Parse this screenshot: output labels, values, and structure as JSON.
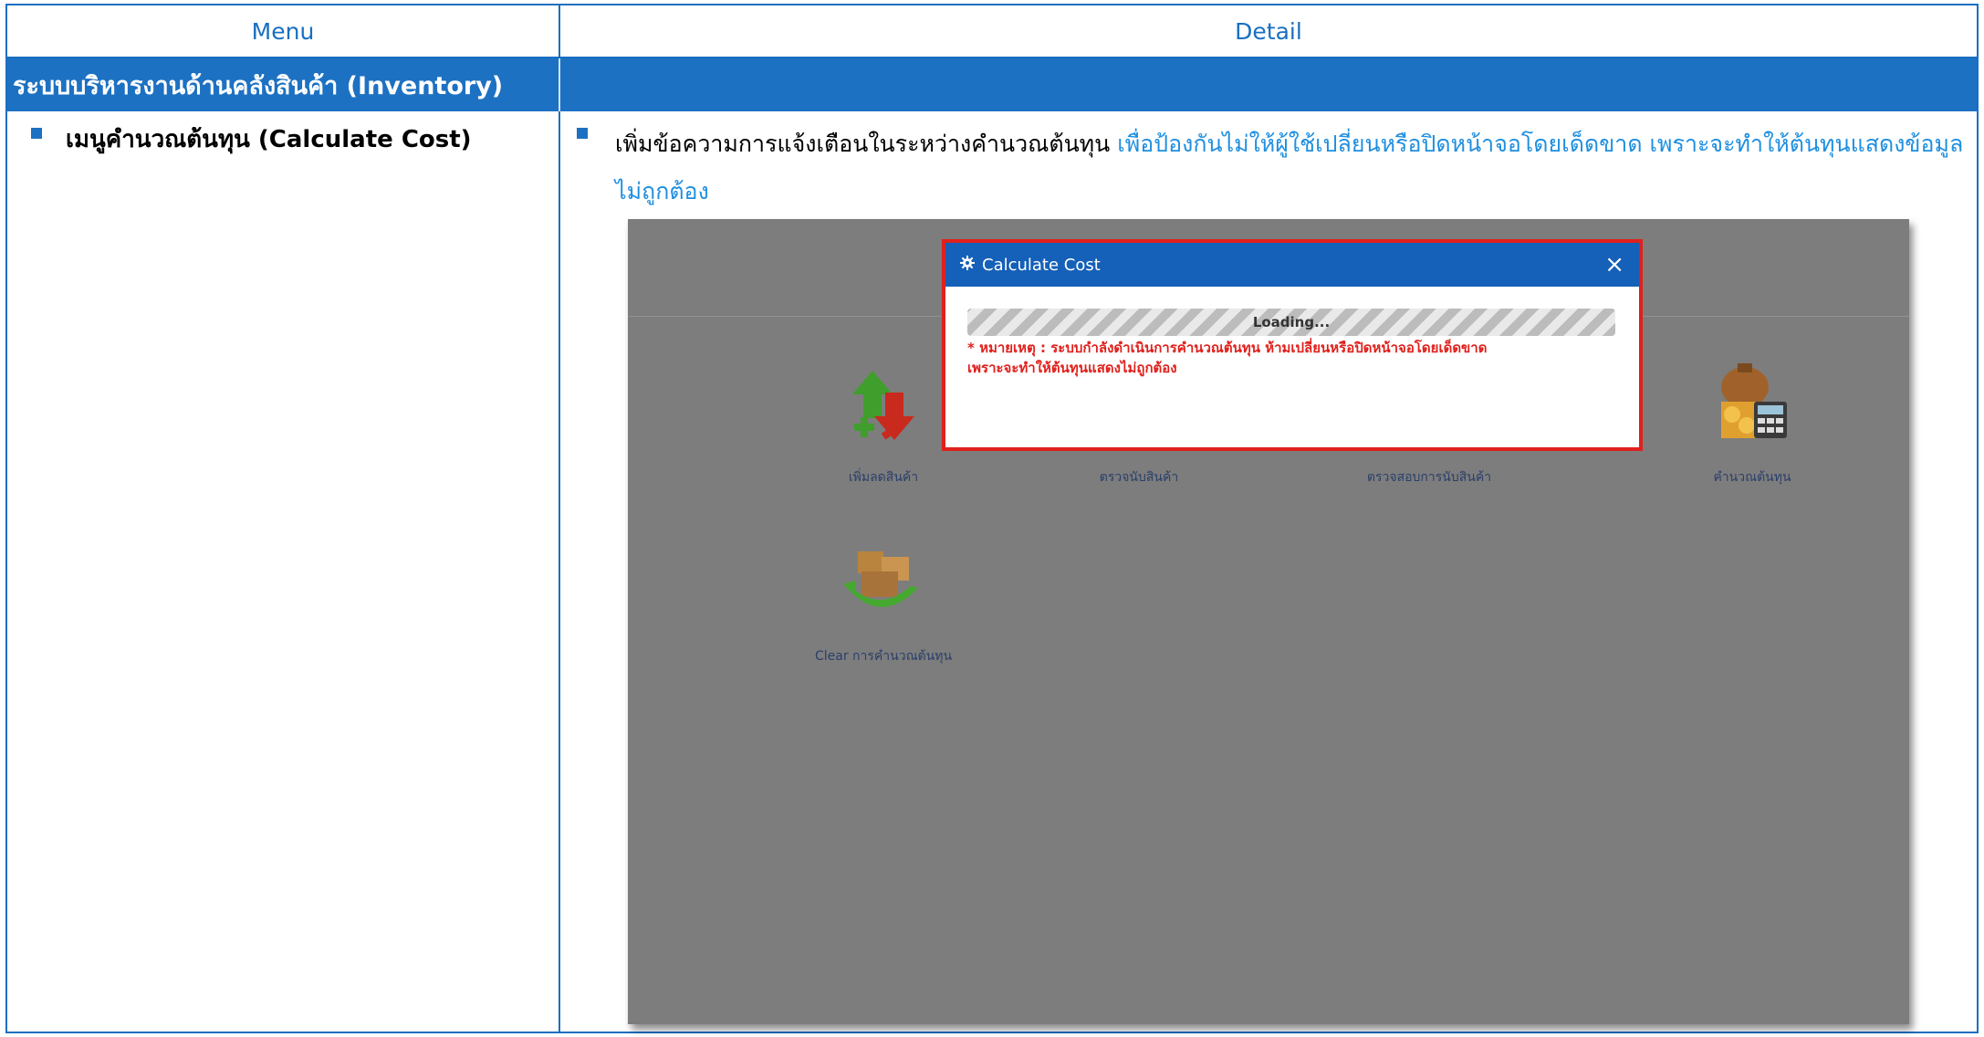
{
  "table": {
    "col_menu": "Menu",
    "col_detail": "Detail"
  },
  "section": {
    "title": "ระบบบริหารงานด้านคลังสินค้า (Inventory)"
  },
  "row": {
    "menu_label": "เมนูคำนวณต้นทุน (Calculate Cost)",
    "detail_plain": "เพิ่มข้อความการแจ้งเตือนในระหว่างคำนวณต้นทุน ",
    "detail_highlight": "เพื่อป้องกันไม่ให้ผู้ใช้เปลี่ยนหรือปิดหน้าจอโดยเด็ดขาด เพราะจะทำให้ต้นทุนแสดงข้อมูลไม่ถูกต้อง"
  },
  "screenshot": {
    "modal": {
      "title": "Calculate Cost",
      "close": "×",
      "progress_label": "Loading...",
      "note_line1": "* หมายเหตุ : ระบบกำลังดำเนินการคำนวณต้นทุน ห้ามเปลี่ยนหรือปิดหน้าจอโดยเด็ดขาด",
      "note_line2": "เพราะจะทำให้ต้นทุนแสดงไม่ถูกต้อง"
    },
    "menu_items": [
      {
        "label": "เพิ่มลดสินค้า",
        "icon": "add-reduce-stock-icon"
      },
      {
        "label": "ตรวจนับสินค้า",
        "icon": "count-stock-icon"
      },
      {
        "label": "ตรวจสอบการนับสินค้า",
        "icon": "verify-count-icon"
      },
      {
        "label": "คำนวณต้นทุน",
        "icon": "calculate-cost-icon"
      },
      {
        "label": "Clear การคำนวณต้นทุน",
        "icon": "clear-calculation-icon"
      }
    ]
  },
  "colors": {
    "accent": "#1d71c2",
    "highlight_text": "#1f8fe0",
    "alert_red": "#e0201c"
  }
}
